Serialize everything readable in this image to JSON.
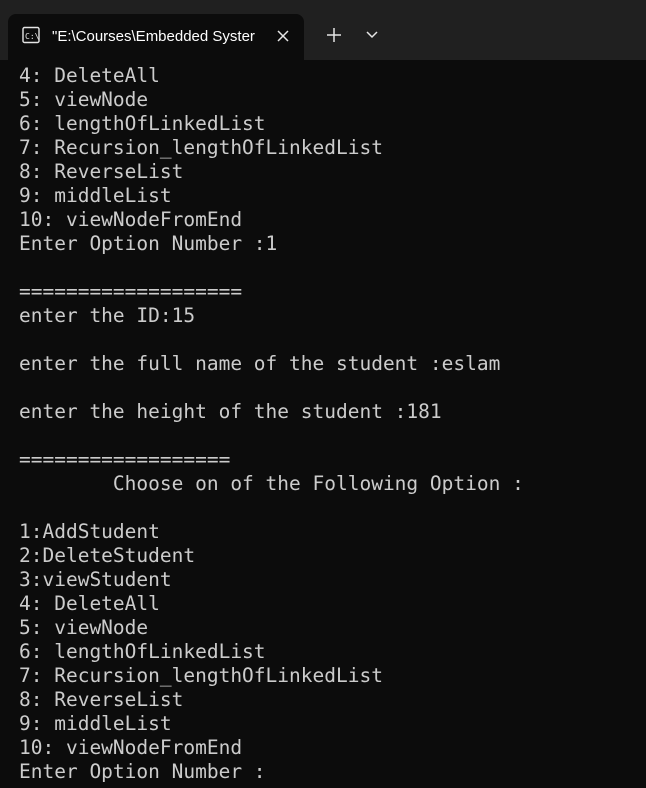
{
  "tab": {
    "title": "\"E:\\Courses\\Embedded Syster",
    "icon": "terminal-icon"
  },
  "tabbar": {
    "close_icon": "close-icon",
    "new_tab_icon": "plus-icon",
    "dropdown_icon": "chevron-down-icon"
  },
  "terminal": {
    "lines": [
      "4: DeleteAll",
      "5: viewNode",
      "6: lengthOfLinkedList",
      "7: Recursion_lengthOfLinkedList",
      "8: ReverseList",
      "9: middleList",
      "10: viewNodeFromEnd",
      "Enter Option Number :1",
      "",
      "===================",
      "enter the ID:15",
      "",
      "enter the full name of the student :eslam",
      "",
      "enter the height of the student :181",
      "",
      "==================",
      "        Choose on of the Following Option :",
      "",
      "1:AddStudent",
      "2:DeleteStudent",
      "3:viewStudent",
      "4: DeleteAll",
      "5: viewNode",
      "6: lengthOfLinkedList",
      "7: Recursion_lengthOfLinkedList",
      "8: ReverseList",
      "9: middleList",
      "10: viewNodeFromEnd",
      "Enter Option Number :"
    ]
  },
  "colors": {
    "background": "#0c0c0c",
    "titlebar": "#202020",
    "text": "#cccccc"
  }
}
